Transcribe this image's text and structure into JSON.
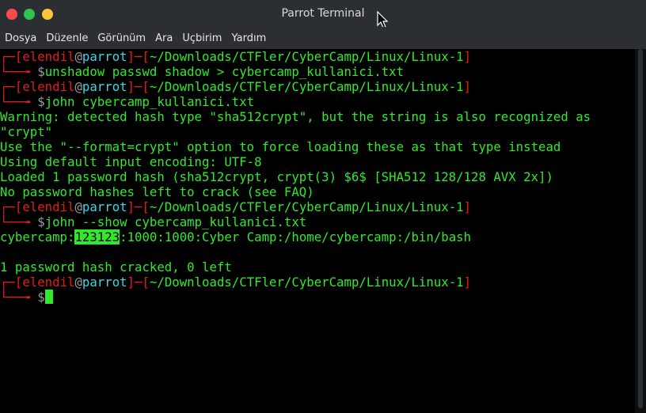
{
  "window": {
    "title": "Parrot Terminal"
  },
  "menu": [
    "Dosya",
    "Düzenle",
    "Görünüm",
    "Ara",
    "Uçbirim",
    "Yardım"
  ],
  "prompt": {
    "user": "elendil",
    "host": "parrot",
    "path": "~/Downloads/CTFler/CyberCamp/Linux/Linux-1"
  },
  "commands": [
    "unshadow passwd shadow > cybercamp_kullanici.txt",
    "john cybercamp_kullanici.txt",
    "john --show cybercamp_kullanici.txt",
    ""
  ],
  "john_output": [
    "Warning: detected hash type \"sha512crypt\", but the string is also recognized as",
    "\"crypt\"",
    "Use the \"--format=crypt\" option to force loading these as that type instead",
    "Using default input encoding: UTF-8",
    "Loaded 1 password hash (sha512crypt, crypt(3) $6$ [SHA512 128/128 AVX 2x])",
    "No password hashes left to crack (see FAQ)"
  ],
  "show_output": {
    "user": "cybercamp",
    "password": "123123",
    "rest": ":1000:1000:Cyber Camp:/home/cybercamp:/bin/bash",
    "summary": "1 password hash cracked, 0 left"
  },
  "colors": {
    "terminal_green": "#31e92b",
    "prompt_red": "#e41c1c",
    "host_cyan": "#3dd7e5",
    "titlebar": "#2b2e33"
  },
  "icons": [
    "close-icon",
    "minimize-icon",
    "maximize-icon",
    "mouse-pointer-icon"
  ]
}
